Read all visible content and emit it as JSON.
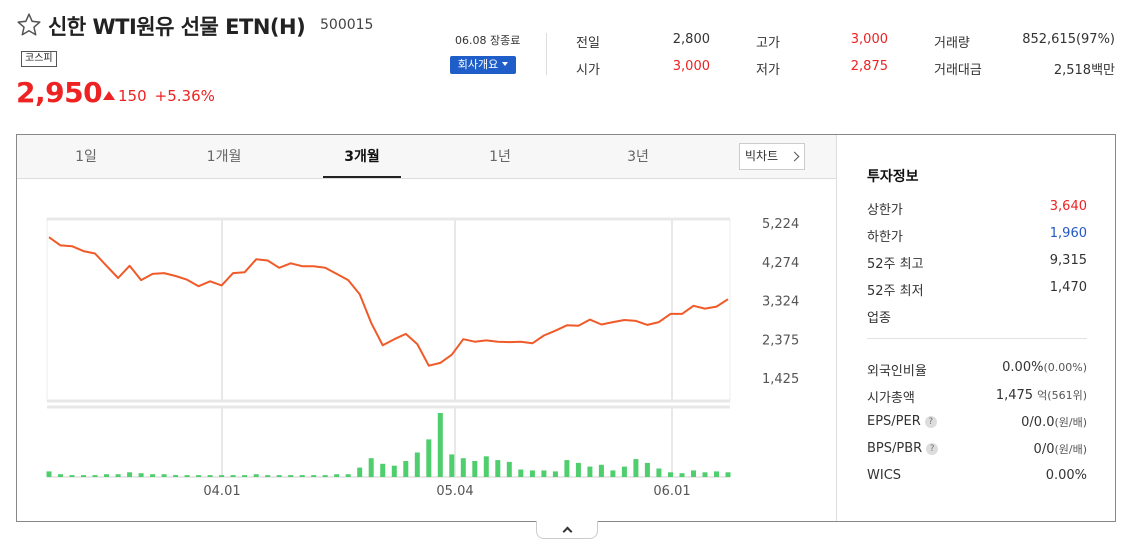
{
  "stock": {
    "name": "신한 WTI원유 선물 ETN(H)",
    "code": "500015",
    "market": "코스피",
    "price": "2,950",
    "change": "150",
    "change_pct": "+5.36%",
    "market_status": "06.08 장종료",
    "company_button": "회사개요"
  },
  "quote": {
    "prev_label": "전일",
    "prev": "2,800",
    "high_label": "고가",
    "high": "3,000",
    "volume_label": "거래량",
    "volume": "852,615(97%)",
    "open_label": "시가",
    "open": "3,000",
    "low_label": "저가",
    "low": "2,875",
    "amount_label": "거래대금",
    "amount": "2,518백만"
  },
  "tabs": [
    {
      "label": "1일",
      "active": false
    },
    {
      "label": "1개월",
      "active": false
    },
    {
      "label": "3개월",
      "active": true
    },
    {
      "label": "1년",
      "active": false
    },
    {
      "label": "3년",
      "active": false
    }
  ],
  "bigchart_button": "빅차트",
  "chart_data": {
    "type": "line",
    "y_ticks": [
      "5,224",
      "4,274",
      "3,324",
      "2,375",
      "1,425"
    ],
    "x_ticks": [
      "04.01",
      "05.04",
      "06.01"
    ],
    "ylim": [
      1425,
      5224
    ],
    "color_price": "#f05a28",
    "color_volume": "#4fce6d",
    "price_series": [
      4900,
      4700,
      4680,
      4560,
      4500,
      4200,
      3900,
      4200,
      3850,
      4000,
      4020,
      3950,
      3860,
      3700,
      3820,
      3720,
      4020,
      4040,
      4360,
      4330,
      4150,
      4260,
      4190,
      4190,
      4150,
      4000,
      3850,
      3500,
      2800,
      2250,
      2400,
      2530,
      2280,
      1750,
      1820,
      2020,
      2400,
      2340,
      2370,
      2340,
      2330,
      2340,
      2300,
      2490,
      2610,
      2740,
      2730,
      2880,
      2760,
      2820,
      2870,
      2850,
      2750,
      2820,
      3020,
      3020,
      3220,
      3150,
      3200,
      3380
    ],
    "volume_series": [
      6,
      3,
      2,
      2,
      2,
      3,
      3,
      5,
      4,
      3,
      3,
      2,
      2,
      2,
      2,
      2,
      2,
      2,
      3,
      2,
      2,
      2,
      2,
      2,
      2,
      3,
      3,
      10,
      20,
      14,
      12,
      17,
      26,
      40,
      68,
      24,
      20,
      17,
      22,
      18,
      16,
      8,
      7,
      7,
      6,
      18,
      15,
      11,
      13,
      7,
      11,
      19,
      15,
      9,
      5,
      4,
      7,
      5,
      6,
      5
    ]
  },
  "info": {
    "title": "투자정보",
    "upper_label": "상한가",
    "upper": "3,640",
    "lower_label": "하한가",
    "lower": "1,960",
    "high52_label": "52주 최고",
    "high52": "9,315",
    "low52_label": "52주 최저",
    "low52": "1,470",
    "sector_label": "업종",
    "foreign_label": "외국인비율",
    "foreign": "0.00%",
    "foreign_sub": "(0.00%)",
    "mcap_label": "시가총액",
    "mcap": "1,475",
    "mcap_unit": "억",
    "mcap_sub": "(561위)",
    "eps_label": "EPS/PER",
    "eps": "0/0.0",
    "eps_unit": "(원/배)",
    "bps_label": "BPS/PBR",
    "bps": "0/0",
    "bps_unit": "(원/배)",
    "wics_label": "WICS",
    "wics": "0.00%"
  }
}
